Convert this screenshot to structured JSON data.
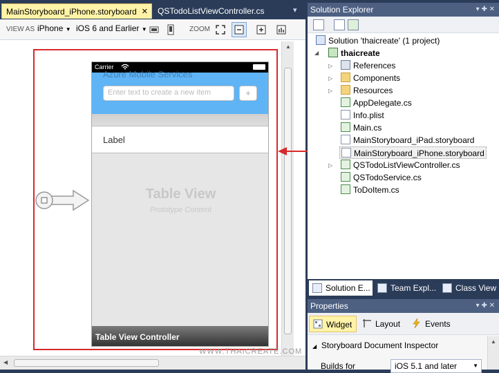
{
  "editor": {
    "tabs": [
      {
        "label": "MainStoryboard_iPhone.storyboard",
        "close": "✕"
      },
      {
        "label": "QSTodoListViewController.cs"
      }
    ],
    "toolbar": {
      "view_as_label": "VIEW AS",
      "device": "iPhone",
      "ios_version": "iOS 6 and Earlier",
      "zoom_label": "ZOOM"
    },
    "canvas": {
      "carrier": "Carrier",
      "header_title": "Azure Mobile Services",
      "input_placeholder": "Enter text to create a new item",
      "add_button": "+",
      "cell_label": "Label",
      "table_view": "Table View",
      "prototype": "Prototype Content",
      "controller_title": "Table View Controller"
    },
    "watermark": "WWW.THAICREATE.COM"
  },
  "solution_explorer": {
    "title": "Solution Explorer",
    "header_controls": "▾ ✚ ✕",
    "solution": "Solution 'thaicreate' (1 project)",
    "project": "thaicreate",
    "items": [
      {
        "label": "References",
        "icon": "references-icon",
        "expandable": true
      },
      {
        "label": "Components",
        "icon": "folder-icon",
        "expandable": true
      },
      {
        "label": "Resources",
        "icon": "folder-icon",
        "expandable": true
      },
      {
        "label": "AppDelegate.cs",
        "icon": "cs-file-icon",
        "expandable": false
      },
      {
        "label": "Info.plist",
        "icon": "plist-file-icon",
        "expandable": false
      },
      {
        "label": "Main.cs",
        "icon": "cs-file-icon",
        "expandable": false
      },
      {
        "label": "MainStoryboard_iPad.storyboard",
        "icon": "storyboard-file-icon",
        "expandable": false
      },
      {
        "label": "MainStoryboard_iPhone.storyboard",
        "icon": "storyboard-file-icon",
        "expandable": false
      },
      {
        "label": "QSTodoListViewController.cs",
        "icon": "cs-file-icon",
        "expandable": true
      },
      {
        "label": "QSTodoService.cs",
        "icon": "cs-file-icon",
        "expandable": false
      },
      {
        "label": "ToDoItem.cs",
        "icon": "cs-file-icon",
        "expandable": false
      }
    ],
    "bottom_tabs": [
      "Solution E...",
      "Team Expl...",
      "Class View"
    ]
  },
  "properties": {
    "title": "Properties",
    "header_controls": "▾ ✚ ✕",
    "tabs": [
      "Widget",
      "Layout",
      "Events"
    ],
    "section": "Storyboard Document Inspector",
    "builds_for_label": "Builds for",
    "builds_for_value": "iOS 5.1 and later"
  },
  "colors": {
    "accent_red": "#d9272a",
    "panel_header": "#4d6082",
    "ios_blue": "#5eb4f5"
  }
}
